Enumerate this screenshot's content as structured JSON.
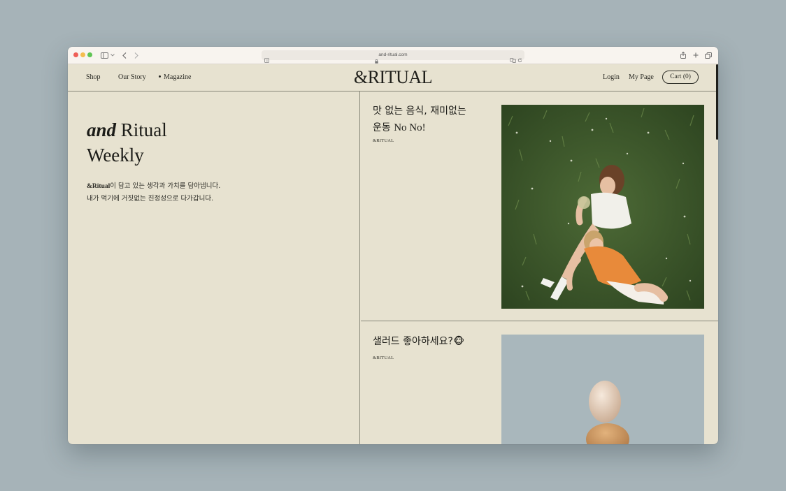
{
  "browser": {
    "url": "and-ritual.com"
  },
  "site": {
    "logo": "&RITUAL",
    "nav_left": [
      "Shop",
      "Our Story",
      "Magazine"
    ],
    "nav_active": "Magazine",
    "login": "Login",
    "my_page": "My Page",
    "cart": "Cart (0)"
  },
  "hero": {
    "title_italic": "and",
    "title_line1_rest": " Ritual",
    "title_line2": "Weekly",
    "desc_brand": "&Ritual",
    "desc_line1_rest": "이 담고 있는 생각과 가치를 담아냅니다.",
    "desc_line2": "내가 먹기에 거짓없는 진정성으로 다가갑니다."
  },
  "articles": [
    {
      "title_line1": "맛 없는 음식, 재미없는",
      "title_line2_ko": "운동 ",
      "title_line2_latin": "No No!",
      "source": "&RITUAL",
      "image": "two women lying in grass photo"
    },
    {
      "title": "샐러드 좋아하세요?🐵",
      "source": "&RITUAL",
      "image": "egg balanced on bread photo"
    }
  ],
  "colors": {
    "page_bg": "#a6b3b8",
    "site_bg": "#e7e2d0",
    "divider": "#878779",
    "text": "#1c1c18"
  },
  "icons": [
    "sidebar-icon",
    "chevron-down-icon",
    "back-icon",
    "forward-icon",
    "page-icon",
    "lock-icon",
    "translate-icon",
    "reload-icon",
    "share-icon",
    "new-tab-icon",
    "tabs-overview-icon"
  ]
}
